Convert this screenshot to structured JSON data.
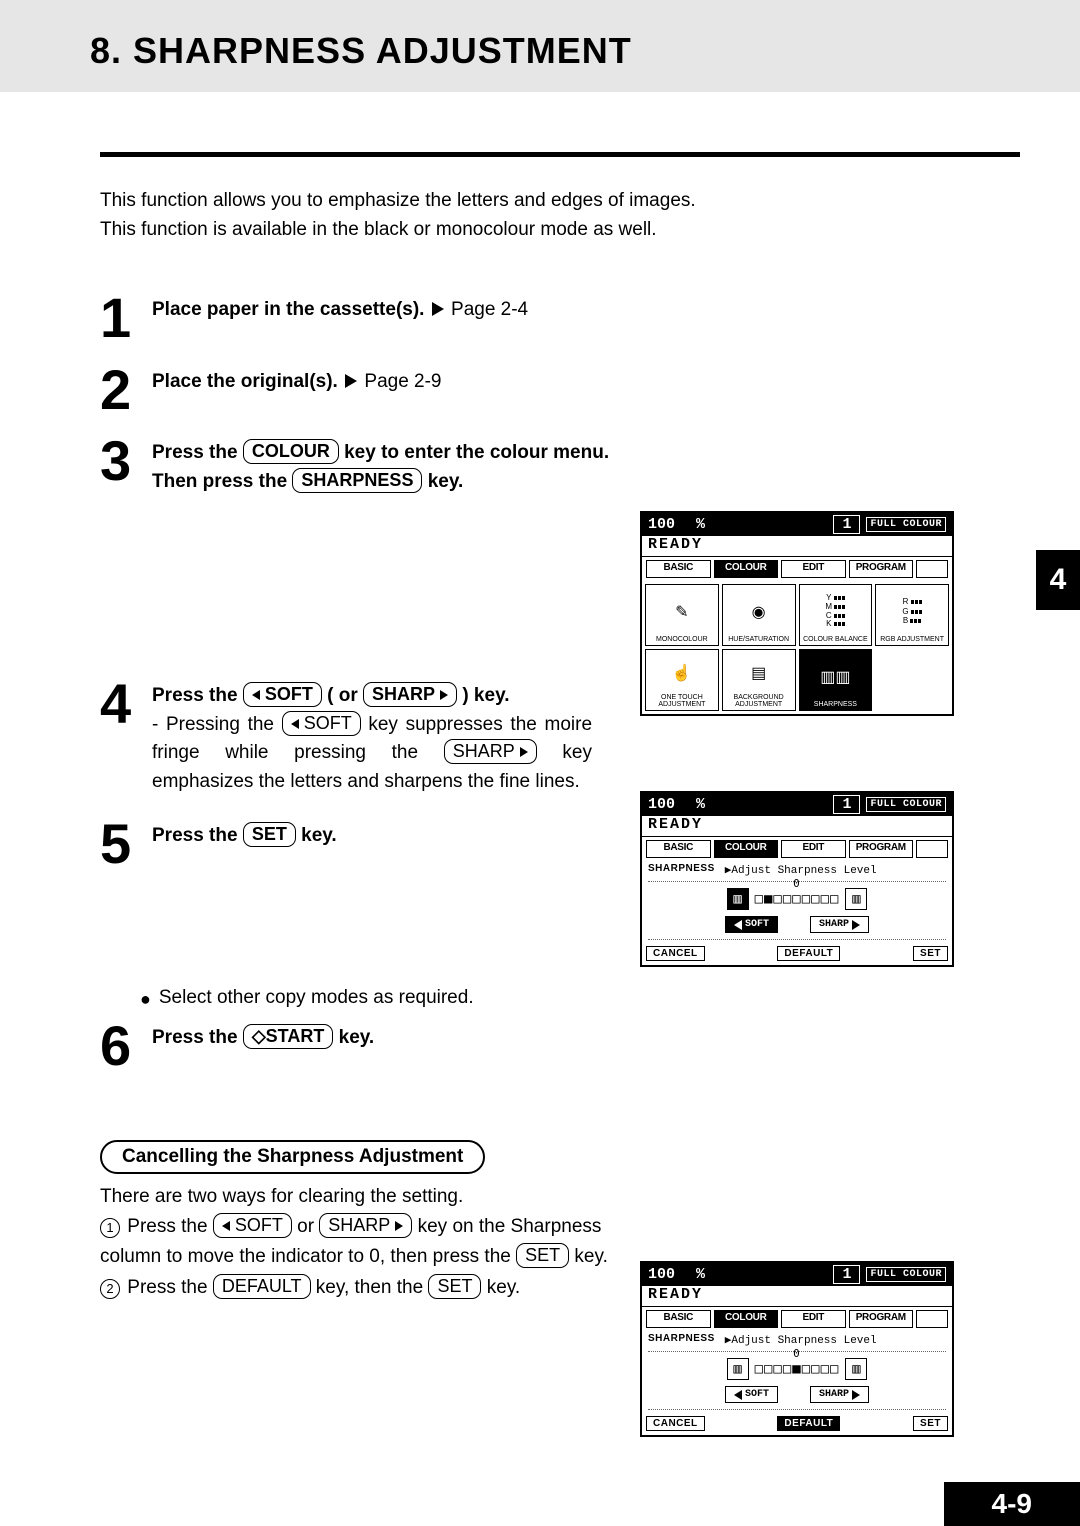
{
  "title": "8. SHARPNESS ADJUSTMENT",
  "thumb_tab": "4",
  "page_number": "4-9",
  "intro_l1": "This function allows you to emphasize the letters and edges of images.",
  "intro_l2": "This function is available in the black or monocolour mode as well.",
  "steps": {
    "s1": {
      "num": "1",
      "bold": "Place paper in the cassette(s).",
      "ref": "Page 2-4"
    },
    "s2": {
      "num": "2",
      "bold": "Place the original(s).",
      "ref": "Page 2-9"
    },
    "s3": {
      "num": "3",
      "p1a": "Press the ",
      "key1": "COLOUR",
      "p1b": " key to enter the colour menu.",
      "p2a": "Then press the ",
      "key2": "SHARPNESS",
      "p2b": " key."
    },
    "s4": {
      "num": "4",
      "p1a": "Press the ",
      "key1": "SOFT",
      "p1b": " ( or ",
      "key2": "SHARP",
      "p1c": " ) key.",
      "desc_a": "- Pressing the ",
      "key3": "SOFT",
      "desc_b": " key suppresses the moire fringe while pressing the ",
      "key4": "SHARP",
      "desc_c": " key emphasizes the letters and sharpens the fine lines."
    },
    "s5": {
      "num": "5",
      "p1a": "Press the ",
      "key1": "SET",
      "p1b": " key."
    },
    "s6": {
      "num": "6",
      "p1a": "Press the ",
      "key1": "START",
      "p1b": " key.",
      "diamond": "◇"
    }
  },
  "bullet": "Select other copy modes as required.",
  "cancel": {
    "title": "Cancelling the Sharpness Adjustment",
    "intro": "There are two ways for clearing the setting.",
    "line1": {
      "a": " Press the ",
      "k1": "SOFT",
      "b": " or ",
      "k2": "SHARP",
      "c": " key on the Sharpness column to move the indicator to 0, then press the ",
      "k3": "SET",
      "d": " key."
    },
    "line2": {
      "a": " Press the ",
      "k1": "DEFAULT",
      "b": " key, then the ",
      "k2": "SET",
      "c": " key."
    }
  },
  "lcd": {
    "zoom": "100",
    "pct": "%",
    "count": "1",
    "fullcolour": "FULL COLOUR",
    "ready": "READY",
    "tabs": {
      "basic": "BASIC",
      "colour": "COLOUR",
      "edit": "EDIT",
      "program": "PROGRAM"
    },
    "grid": {
      "monocolour": "MONOCOLOUR",
      "hue": "HUE/SATURATION",
      "colbal": "COLOUR BALANCE",
      "rgb": "RGB ADJUSTMENT",
      "onetouch": "ONE TOUCH ADJUSTMENT",
      "bg": "BACKGROUND ADJUSTMENT",
      "sharpness_label": "SHARPNESS",
      "ymck": {
        "y": "Y",
        "m": "M",
        "c": "C",
        "k": "K"
      },
      "rgb_letters": {
        "r": "R",
        "g": "G",
        "b": "B"
      }
    },
    "sharp_screen": {
      "label": "SHARPNESS",
      "msg": "Adjust Sharpness Level",
      "soft": "SOFT",
      "sharp": "SHARP",
      "cancel": "CANCEL",
      "default": "DEFAULT",
      "set": "SET",
      "zero": "0"
    },
    "notches_soft": "□■□□□□□□□",
    "notches_zero": "□□□□■□□□□"
  }
}
